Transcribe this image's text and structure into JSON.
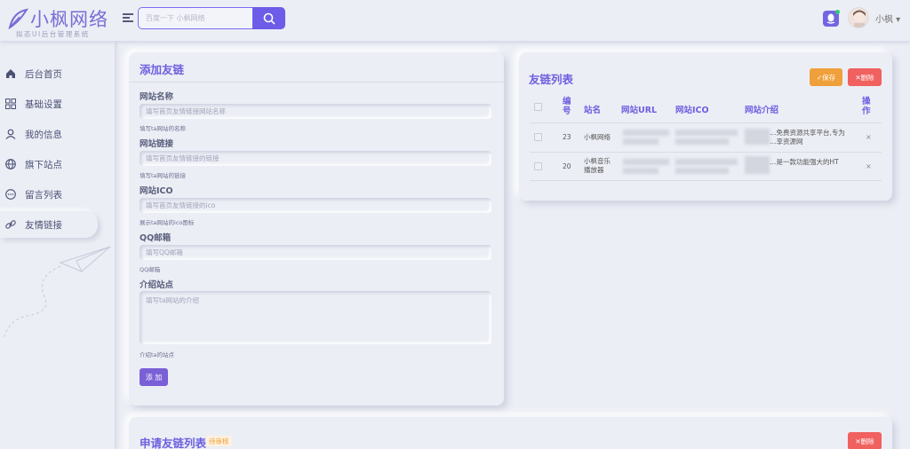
{
  "brand": {
    "name": "小枫网络",
    "tagline": "拟态UI后台管理系统",
    "accent": "#6c5ce7"
  },
  "header": {
    "search_placeholder": "百度一下 小枫网络",
    "user_name": "小枫 ▾"
  },
  "sidebar": {
    "items": [
      {
        "label": "后台首页",
        "icon": "home-icon"
      },
      {
        "label": "基础设置",
        "icon": "grid-icon"
      },
      {
        "label": "我的信息",
        "icon": "user-icon"
      },
      {
        "label": "旗下站点",
        "icon": "globe-icon"
      },
      {
        "label": "留言列表",
        "icon": "chat-icon"
      },
      {
        "label": "友情链接",
        "icon": "link-icon",
        "active": true
      }
    ]
  },
  "add_form": {
    "title": "添加友链",
    "fields": [
      {
        "label": "网站名称",
        "placeholder": "填写首页友情链接网站名称",
        "help": "填写ta网站的名称"
      },
      {
        "label": "网站链接",
        "placeholder": "填写首页友情链接的链接",
        "help": "填写ta网站的链接"
      },
      {
        "label": "网站ICO",
        "placeholder": "填写首页友情链接的ico",
        "help": "展示ta网站的ico图标"
      },
      {
        "label": "QQ邮箱",
        "placeholder": "填写QQ邮箱",
        "help": "QQ邮箱"
      }
    ],
    "intro": {
      "label": "介绍站点",
      "placeholder": "填写ta网站的介绍",
      "help": "介绍ta的站点"
    },
    "submit_label": "添 加"
  },
  "link_list": {
    "title": "友链列表",
    "save_label": "✓保存",
    "delete_label": "✕删除",
    "headers": [
      "编号",
      "站名",
      "网站URL",
      "网站ICO",
      "网站介绍",
      "操作"
    ],
    "rows": [
      {
        "id": "23",
        "name": "小枫网络",
        "intro_top": "…免费资源共享平台,专为",
        "intro_bottom": "…享资源网",
        "action": "×"
      },
      {
        "id": "20",
        "name": "小枫音乐播放器",
        "intro_top": "…是一款功能强大的HT",
        "intro_bottom": "",
        "action": "×"
      }
    ]
  },
  "apply_list": {
    "title": "申请友链列表",
    "badge": "待审核",
    "delete_label": "✕删除"
  }
}
